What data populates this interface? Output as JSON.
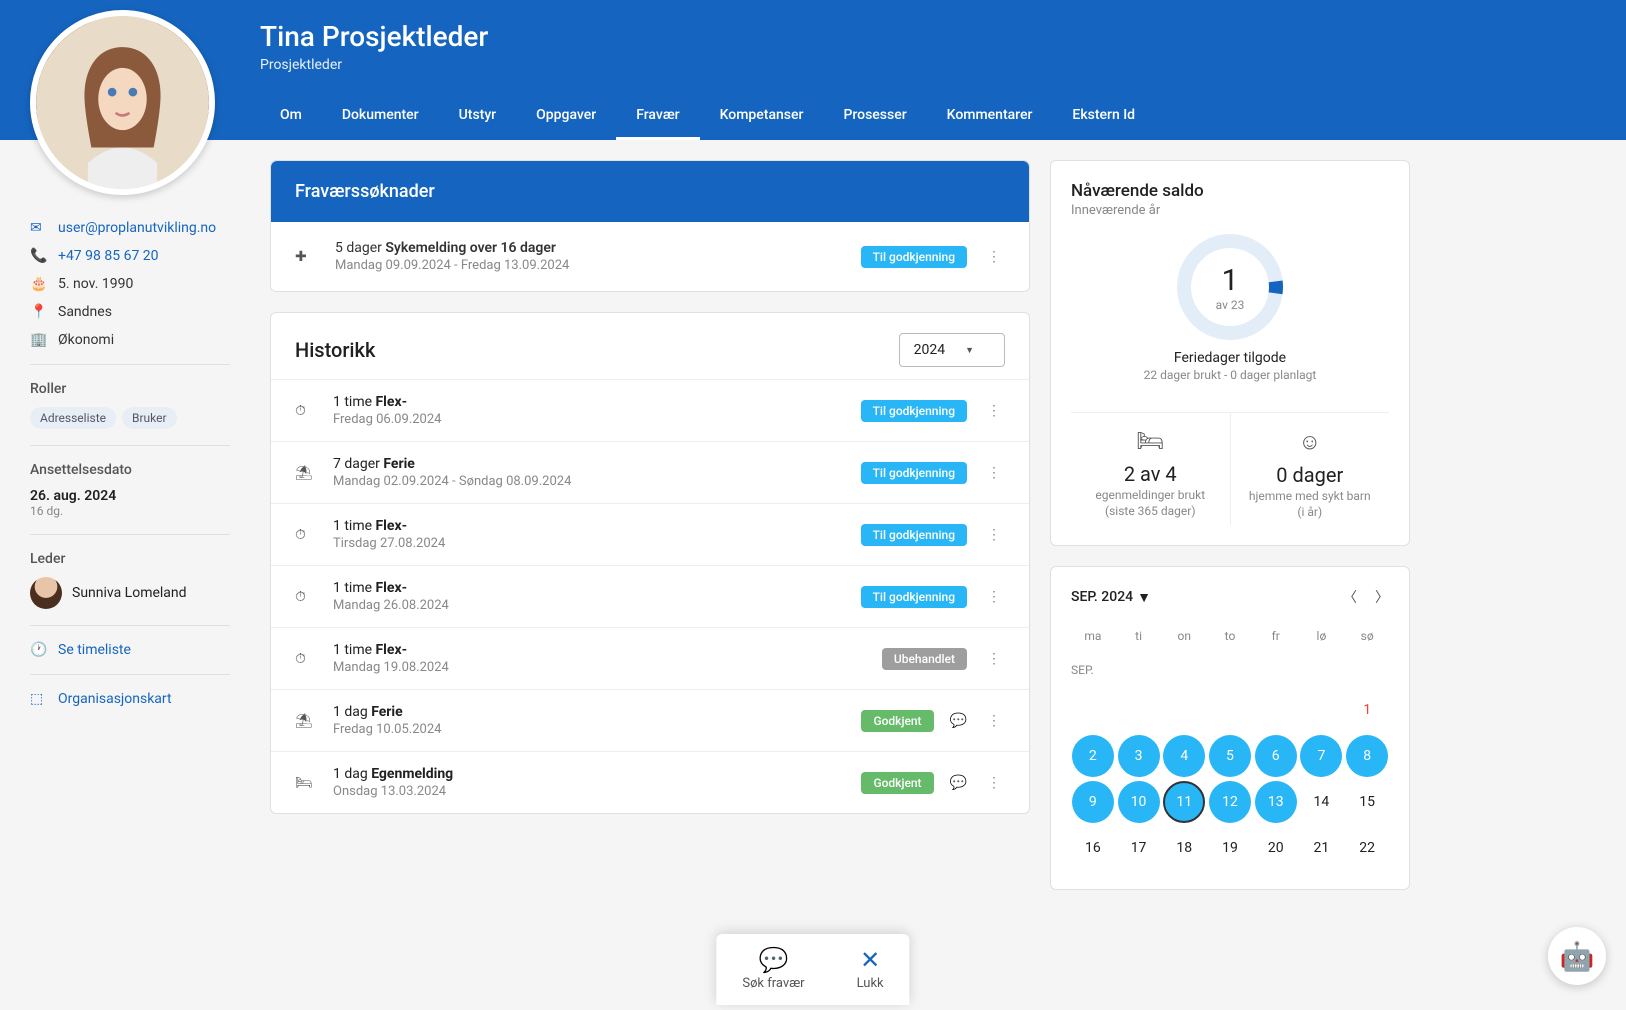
{
  "header": {
    "name": "Tina Prosjektleder",
    "role": "Prosjektleder",
    "tabs": [
      "Om",
      "Dokumenter",
      "Utstyr",
      "Oppgaver",
      "Fravær",
      "Kompetanser",
      "Prosesser",
      "Kommentarer",
      "Ekstern Id"
    ],
    "active_tab": 4
  },
  "sidebar": {
    "email": "user@proplanutvikling.no",
    "phone": "+47 98 85 67 20",
    "birthdate": "5. nov. 1990",
    "location": "Sandnes",
    "department": "Økonomi",
    "roles_label": "Roller",
    "roles": [
      "Adresseliste",
      "Bruker"
    ],
    "hire_label": "Ansettelsesdato",
    "hire_date": "26. aug. 2024",
    "hire_duration": "16 dg.",
    "leader_label": "Leder",
    "leader_name": "Sunniva Lomeland",
    "timesheet": "Se timeliste",
    "orgchart": "Organisasjonskart"
  },
  "requests": {
    "title": "Fraværssøknader",
    "items": [
      {
        "icon": "bandage",
        "prefix": "5 dager ",
        "type": "Sykemelding over 16 dager",
        "dates": "Mandag 09.09.2024 - Fredag 13.09.2024",
        "status": "pending",
        "status_label": "Til godkjenning"
      }
    ]
  },
  "history": {
    "title": "Historikk",
    "year": "2024",
    "items": [
      {
        "icon": "timer",
        "prefix": "1 time ",
        "type": "Flex-",
        "dates": "Fredag 06.09.2024",
        "status": "pending",
        "status_label": "Til godkjenning",
        "comment": false
      },
      {
        "icon": "umbrella",
        "prefix": "7 dager ",
        "type": "Ferie",
        "dates": "Mandag 02.09.2024 - Søndag 08.09.2024",
        "status": "pending",
        "status_label": "Til godkjenning",
        "comment": false
      },
      {
        "icon": "timer",
        "prefix": "1 time ",
        "type": "Flex-",
        "dates": "Tirsdag 27.08.2024",
        "status": "pending",
        "status_label": "Til godkjenning",
        "comment": false
      },
      {
        "icon": "timer",
        "prefix": "1 time ",
        "type": "Flex-",
        "dates": "Mandag 26.08.2024",
        "status": "pending",
        "status_label": "Til godkjenning",
        "comment": false
      },
      {
        "icon": "timer",
        "prefix": "1 time ",
        "type": "Flex-",
        "dates": "Mandag 19.08.2024",
        "status": "unhandled",
        "status_label": "Ubehandlet",
        "comment": false
      },
      {
        "icon": "umbrella",
        "prefix": "1 dag ",
        "type": "Ferie",
        "dates": "Fredag 10.05.2024",
        "status": "approved",
        "status_label": "Godkjent",
        "comment": true
      },
      {
        "icon": "bed",
        "prefix": "1 dag ",
        "type": "Egenmelding",
        "dates": "Onsdag 13.03.2024",
        "status": "approved",
        "status_label": "Godkjent",
        "comment": true
      }
    ]
  },
  "saldo": {
    "title": "Nåværende saldo",
    "subtitle": "Inneværende år",
    "donut_value": "1",
    "donut_total": "av 23",
    "vacation_label": "Feriedager tilgode",
    "vacation_sub": "22 dager brukt - 0 dager planlagt",
    "col1_value": "2 av 4",
    "col1_label": "egenmeldinger brukt",
    "col1_sub": "(siste 365 dager)",
    "col2_value": "0 dager",
    "col2_label": "hjemme med sykt barn",
    "col2_sub": "(i år)"
  },
  "calendar": {
    "month_label": "SEP. 2024",
    "dow": [
      "ma",
      "ti",
      "on",
      "to",
      "fr",
      "lø",
      "sø"
    ],
    "month_short": "SEP.",
    "days": [
      {
        "n": "",
        "s": ""
      },
      {
        "n": "",
        "s": ""
      },
      {
        "n": "",
        "s": ""
      },
      {
        "n": "",
        "s": ""
      },
      {
        "n": "",
        "s": ""
      },
      {
        "n": "",
        "s": ""
      },
      {
        "n": "1",
        "s": "red"
      },
      {
        "n": "2",
        "s": "blue"
      },
      {
        "n": "3",
        "s": "blue"
      },
      {
        "n": "4",
        "s": "blue"
      },
      {
        "n": "5",
        "s": "blue"
      },
      {
        "n": "6",
        "s": "blue"
      },
      {
        "n": "7",
        "s": "blue"
      },
      {
        "n": "8",
        "s": "blue"
      },
      {
        "n": "9",
        "s": "blue"
      },
      {
        "n": "10",
        "s": "blue"
      },
      {
        "n": "11",
        "s": "blue today"
      },
      {
        "n": "12",
        "s": "blue"
      },
      {
        "n": "13",
        "s": "blue"
      },
      {
        "n": "14",
        "s": ""
      },
      {
        "n": "15",
        "s": ""
      },
      {
        "n": "16",
        "s": ""
      },
      {
        "n": "17",
        "s": ""
      },
      {
        "n": "18",
        "s": ""
      },
      {
        "n": "19",
        "s": ""
      },
      {
        "n": "20",
        "s": ""
      },
      {
        "n": "21",
        "s": ""
      },
      {
        "n": "22",
        "s": ""
      }
    ]
  },
  "fab": {
    "request": "Søk fravær",
    "close": "Lukk"
  }
}
